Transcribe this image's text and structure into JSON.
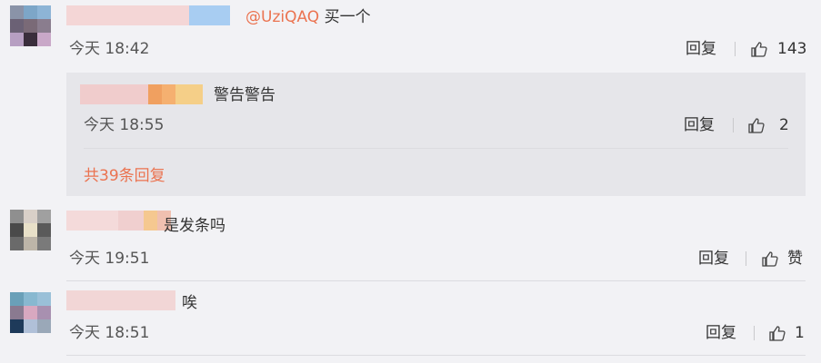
{
  "comments": [
    {
      "mention": "@UziQAQ",
      "text": " 买一个",
      "time": "今天 18:42",
      "reply_label": "回复",
      "likes": "143"
    },
    {
      "text": "是发条吗",
      "time": "今天 19:51",
      "reply_label": "回复",
      "likes": "赞"
    },
    {
      "text": "唉",
      "time": "今天 18:51",
      "reply_label": "回复",
      "likes": "1"
    }
  ],
  "sub_reply": {
    "text": "警告警告",
    "time": "今天 18:55",
    "reply_label": "回复",
    "likes": "2"
  },
  "more_replies": "共39条回复",
  "colors": {
    "accent": "#eb7350",
    "background": "#f2f2f5",
    "reply_box": "#e6e6ea"
  },
  "icons": [
    "thumbs-up-icon"
  ]
}
